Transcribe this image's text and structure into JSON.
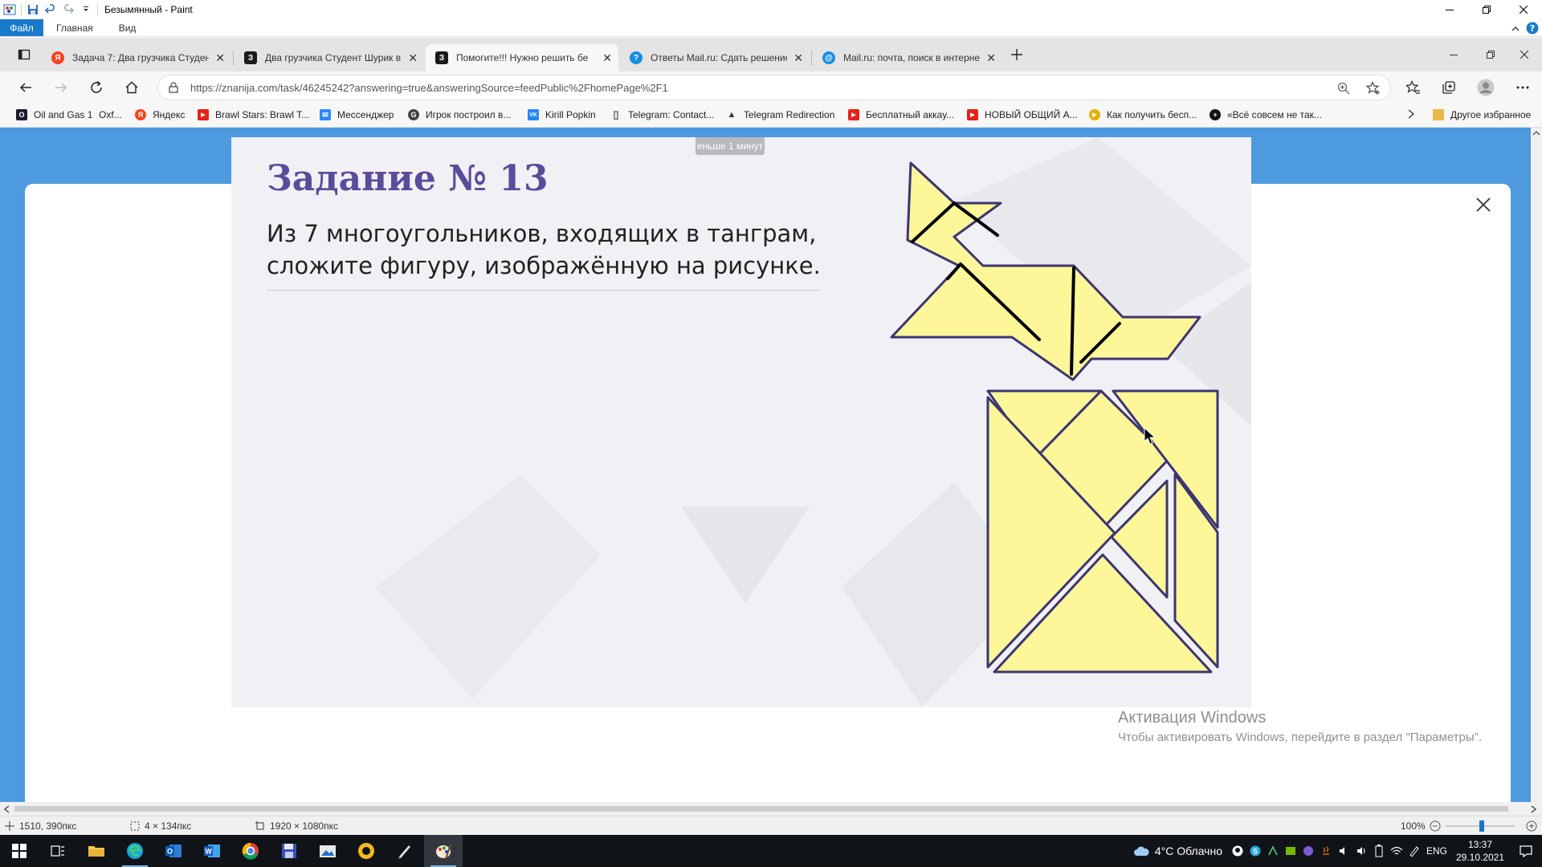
{
  "paint": {
    "window_title": "Безымянный - Paint",
    "ribbon_tabs": [
      "Файл",
      "Главная",
      "Вид"
    ],
    "status": {
      "cursor_pos": "1510, 390пкс",
      "selection_size": "4 × 134пкс",
      "image_size": "1920 × 1080пкс",
      "zoom": "100%"
    }
  },
  "browser": {
    "tabs": [
      {
        "label": "Задача 7: Два грузчика Студент",
        "favicon": "Я",
        "color": "#fc3f1d"
      },
      {
        "label": "Два грузчика Студент Шурик в",
        "favicon": "З",
        "color": "#1b1b1b"
      },
      {
        "label": "Помогите!!! Нужно решить бе",
        "favicon": "З",
        "color": "#1b1b1b"
      },
      {
        "label": "Ответы Mail.ru: Сдать решение",
        "favicon": "?",
        "color": "#168de2"
      },
      {
        "label": "Mail.ru: почта, поиск в интерне",
        "favicon": "@",
        "color": "#168de2"
      }
    ],
    "active_tab_index": 2,
    "url": "https://znanija.com/task/46245242?answering=true&answeringSource=feedPublic%2FhomePage%2F1",
    "bookmarks": [
      {
        "label": "Oil and Gas 1",
        "icon": "O",
        "color": "#222"
      },
      {
        "label": "Oxf...",
        "icon": "",
        "color": "transparent"
      },
      {
        "label": "Яндекс",
        "icon": "Я",
        "color": "#fc3f1d"
      },
      {
        "label": "Brawl Stars: Brawl T...",
        "icon": "▶",
        "color": "#e62117"
      },
      {
        "label": "Мессенджер",
        "icon": "✉",
        "color": "#2d88ff"
      },
      {
        "label": "Игрок построил в...",
        "icon": "G",
        "color": "#444"
      },
      {
        "label": "Kirill Popkin",
        "icon": "VK",
        "color": "#2787f5"
      },
      {
        "label": "Telegram: Contact...",
        "icon": "▯",
        "color": "#888"
      },
      {
        "label": "Telegram Redirection",
        "icon": "▲",
        "color": "#333"
      },
      {
        "label": "Бесплатный аккау...",
        "icon": "▶",
        "color": "#e62117"
      },
      {
        "label": "НОВЫЙ ОБЩИЙ А...",
        "icon": "▶",
        "color": "#e62117"
      },
      {
        "label": "Как получить бесп...",
        "icon": "▶",
        "color": "#e0b000"
      },
      {
        "label": "«Всё совсем не так...",
        "icon": "+",
        "color": "#111"
      }
    ],
    "bookmarks_other": "Другое избранное"
  },
  "slide": {
    "title": "Задание № 13",
    "line1": "Из 7 многоугольников, входящих в танграм,",
    "line2": "сложите фигуру, изображённую на рисунке.",
    "timer": "еньше 1 минут"
  },
  "watermark": {
    "line1": "Активация Windows",
    "line2": "Чтобы активировать Windows, перейдите в раздел \"Параметры\"."
  },
  "taskbar": {
    "weather": "4°C Облачно",
    "lang": "ENG",
    "time": "13:37",
    "date": "29.10.2021"
  },
  "colors": {
    "tangram_fill": "#fdf799",
    "tangram_stroke": "#3c3570",
    "page_blue": "#4e9ade",
    "file_tab": "#1979ca"
  }
}
